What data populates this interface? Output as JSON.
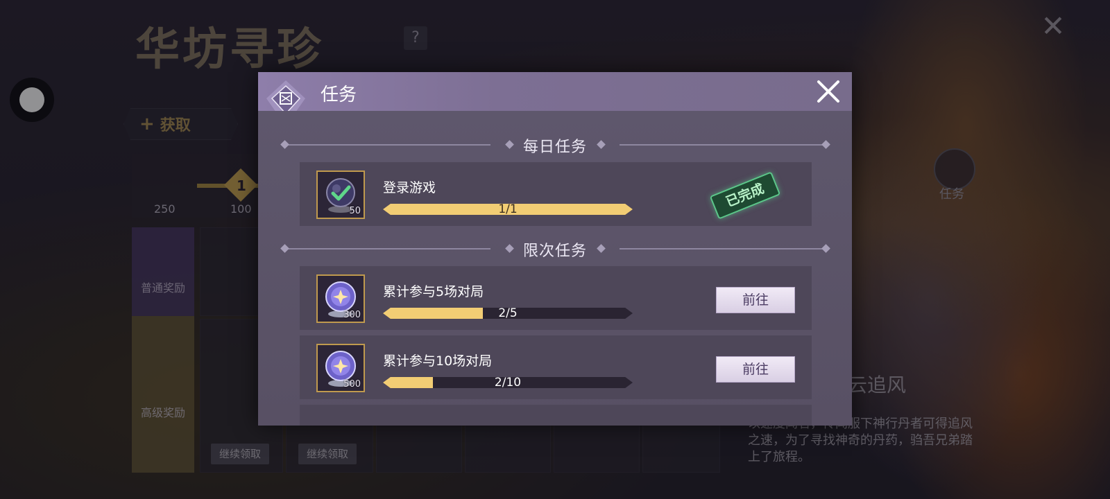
{
  "background": {
    "title": "华坊寻珍",
    "help_label": "?",
    "close_label": "✕",
    "get_button": {
      "icon": "+",
      "label": "获取"
    },
    "track": {
      "left_value": "250",
      "node_value": "100",
      "node_number": "1"
    },
    "side_tabs": {
      "normal": "普通奖励",
      "premium": "高级奖励"
    },
    "claim_buttons": [
      "继续领取",
      "继续领取"
    ],
    "task_entry_label": "任务",
    "skin_name": "云追风",
    "description": "以速度闻名，传闻服下神行丹者可得追风之速，为了寻找神奇的丹药，驺吾兄弟踏上了旅程。"
  },
  "modal": {
    "title": "任务",
    "close_icon": "close-icon",
    "daily_section_title": "每日任务",
    "limited_section_title": "限次任务",
    "daily_tasks": [
      {
        "name": "登录游戏",
        "progress_text": "1/1",
        "progress": 1.0,
        "reward_qty": "50",
        "reward_icon": "crystal-orb-checked-icon",
        "status": "已完成"
      }
    ],
    "limited_tasks": [
      {
        "name": "累计参与5场对局",
        "progress_text": "2/5",
        "progress": 0.4,
        "reward_qty": "300",
        "reward_icon": "crystal-orb-icon",
        "button": "前往"
      },
      {
        "name": "累计参与10场对局",
        "progress_text": "2/10",
        "progress": 0.2,
        "reward_qty": "500",
        "reward_icon": "crystal-orb-icon",
        "button": "前往"
      }
    ]
  },
  "colors": {
    "progress_fill": "#f2cd74",
    "done_stamp": "#5cc78a",
    "header": "#8e7eaa"
  }
}
